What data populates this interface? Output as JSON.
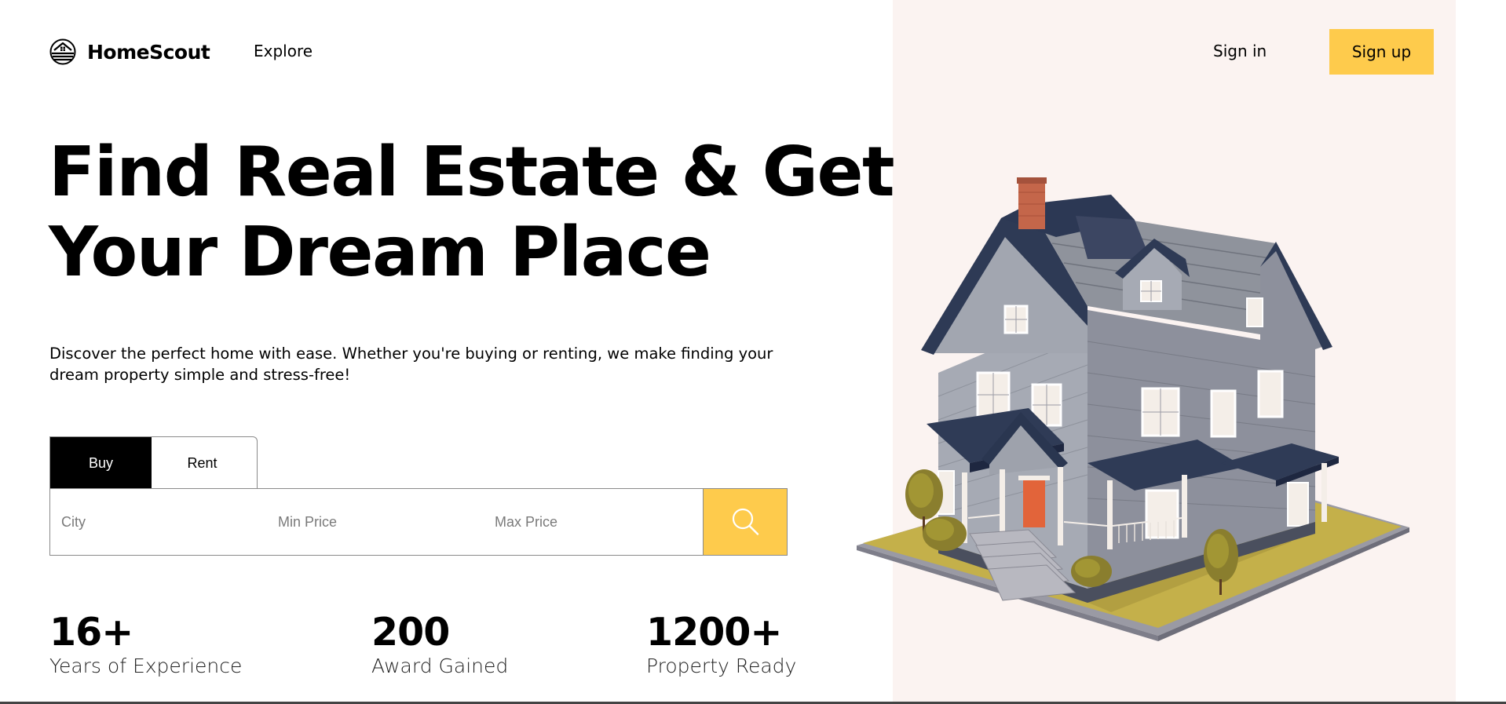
{
  "brand": {
    "name": "HomeScout",
    "logo_icon": "house-sunset-logo-icon"
  },
  "nav": {
    "explore": "Explore",
    "sign_in": "Sign in",
    "sign_up": "Sign up"
  },
  "hero": {
    "title_line1": "Find Real Estate & Get",
    "title_line2": "Your Dream Place",
    "description_line1": "Discover the perfect home with ease. Whether you're buying or renting, we make finding your",
    "description_line2": "dream property simple and stress-free!"
  },
  "search": {
    "tabs": [
      {
        "label": "Buy",
        "active": true
      },
      {
        "label": "Rent",
        "active": false
      }
    ],
    "city_placeholder": "City",
    "min_price_placeholder": "Min Price",
    "max_price_placeholder": "Max Price",
    "button_icon": "search-icon"
  },
  "stats": [
    {
      "value": "16+",
      "label": "Years of Experience"
    },
    {
      "value": "200",
      "label": "Award Gained"
    },
    {
      "value": "1200+",
      "label": "Property Ready"
    }
  ],
  "colors": {
    "accent": "#fecb4c",
    "panel_bg": "#fbf3f1",
    "tab_active_bg": "#000000",
    "text": "#000000"
  }
}
